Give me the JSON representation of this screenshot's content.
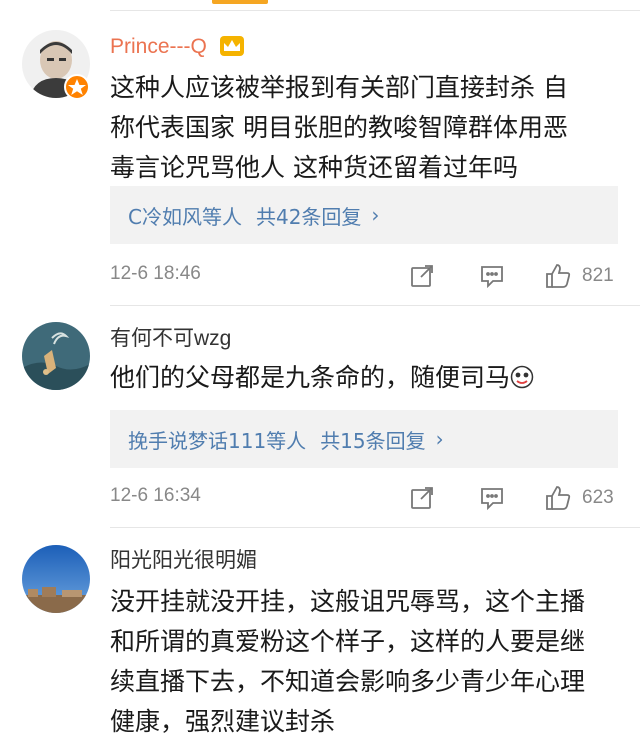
{
  "comments": [
    {
      "username": "Prince---Q",
      "text_lines": [
        "这种人应该被举报到有关部门直接封杀  自",
        "称代表国家  明目张胆的教唆智障群体用恶",
        "毒言论咒骂他人  这种货还留着过年吗"
      ],
      "reply": {
        "names": "C冷如风等人",
        "count": "共42条回复",
        "chevron": "›"
      },
      "timestamp": "12-6 18:46",
      "likes": "821"
    },
    {
      "username": "有何不可wzg",
      "text_lines": [
        "他们的父母都是九条命的，随便司马"
      ],
      "reply": {
        "names": "挽手说梦话111等人",
        "count": "共15条回复",
        "chevron": "›"
      },
      "timestamp": "12-6 16:34",
      "likes": "623"
    },
    {
      "username": "阳光阳光很明媚",
      "text_lines": [
        "没开挂就没开挂，这般诅咒辱骂，这个主播",
        "和所谓的真爱粉这个样子，这样的人要是继",
        "续直播下去，不知道会影响多少青少年心理",
        "健康，强烈建议封杀"
      ]
    }
  ],
  "colors": {
    "username_vip": "#eb7350",
    "reply_link": "#507daf",
    "meta_gray": "#888888",
    "reply_bg": "#f2f2f2",
    "tab_indicator": "#f5a623"
  },
  "icons": [
    "crown-icon",
    "vip-badge-icon",
    "share-icon",
    "comment-icon",
    "like-icon",
    "emoji-icon"
  ]
}
